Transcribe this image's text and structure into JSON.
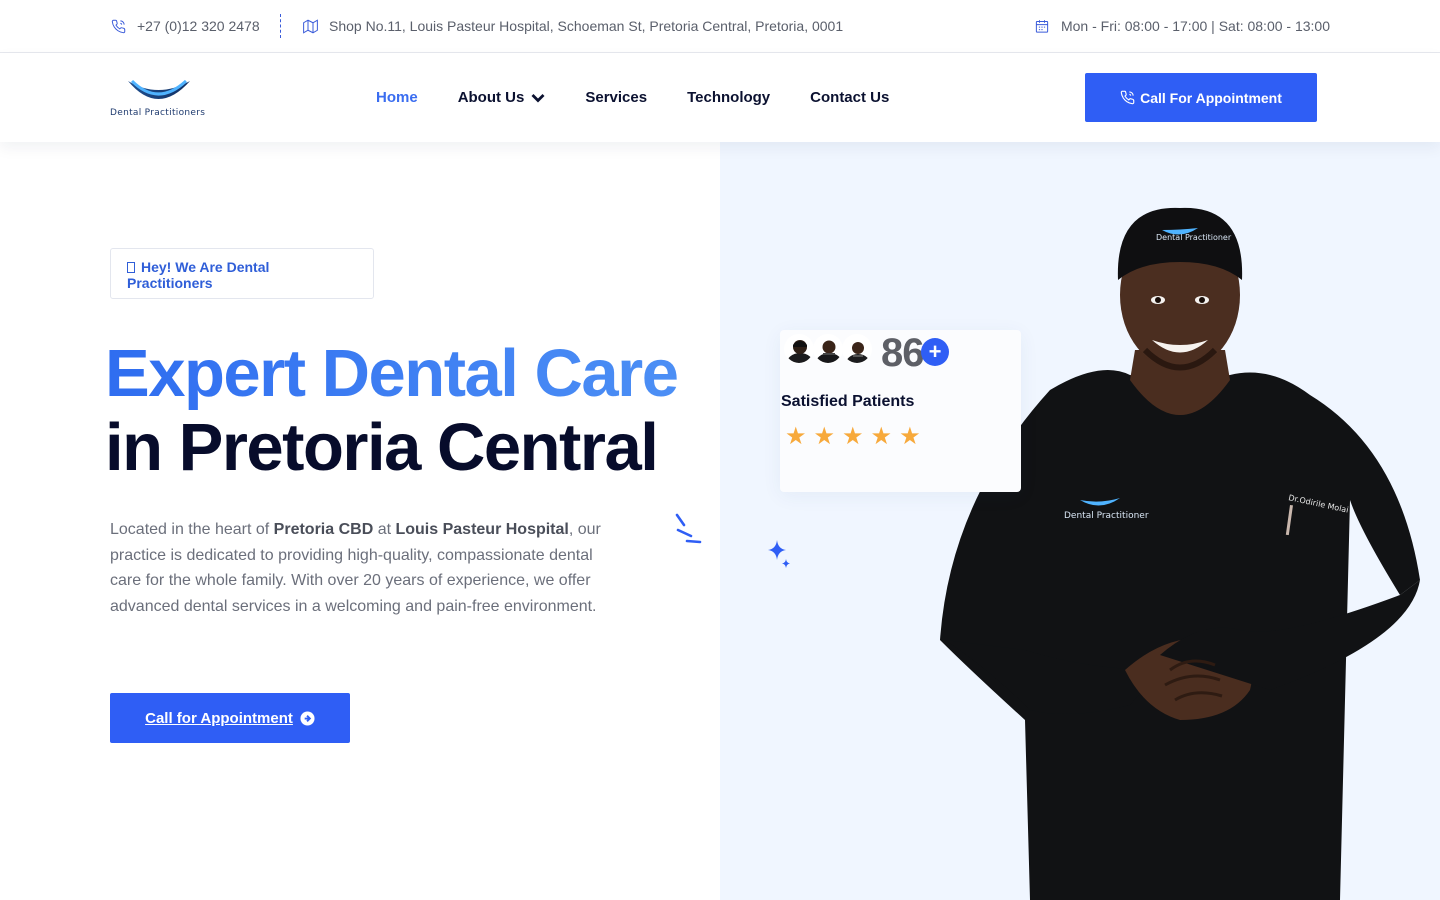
{
  "topbar": {
    "phone": "+27 (0)12 320 2478",
    "address": "Shop No.11, Louis Pasteur Hospital, Schoeman St, Pretoria Central, Pretoria, 0001",
    "hours": "Mon - Fri: 08:00 - 17:00 | Sat: 08:00 - 13:00",
    "icons": [
      "phone-icon",
      "map-icon",
      "calendar-icon"
    ]
  },
  "header": {
    "logo_text": "Dental Practitioners",
    "nav": [
      {
        "label": "Home",
        "active": true
      },
      {
        "label": "About Us",
        "has_dropdown": true
      },
      {
        "label": "Services"
      },
      {
        "label": "Technology"
      },
      {
        "label": "Contact Us"
      }
    ],
    "cta_label": "Call For Appointment"
  },
  "hero": {
    "tagline": "Hey! We Are Dental Practitioners",
    "title_line1": "Expert Dental Care",
    "title_line2": "in Pretoria Central",
    "desc_parts": {
      "p1": "Located in the heart of ",
      "b1": "Pretoria CBD",
      "p2": " at ",
      "b2": "Louis Pasteur Hospital",
      "p3": ", our practice is dedicated to providing high-quality, compassionate dental care for the whole family. With over 20 years of experience, we offer advanced dental services in a welcoming and pain-free environment."
    },
    "cta_label": "Call for Appointment"
  },
  "stats": {
    "number": "86",
    "plus": "+",
    "label": "Satisfied Patients",
    "rating": 5,
    "star_glyph": "★"
  },
  "colors": {
    "accent": "#2f5ef5",
    "title_blue": "#3a7af5",
    "dark": "#070c2b",
    "star": "#f7a93b",
    "hero_bg": "#f0f6ff"
  },
  "doctor": {
    "cap_text": "Dental Practitioner",
    "shirt_text": "Dental Practitioner",
    "badge_text": "Dr.Odirile Molai"
  }
}
